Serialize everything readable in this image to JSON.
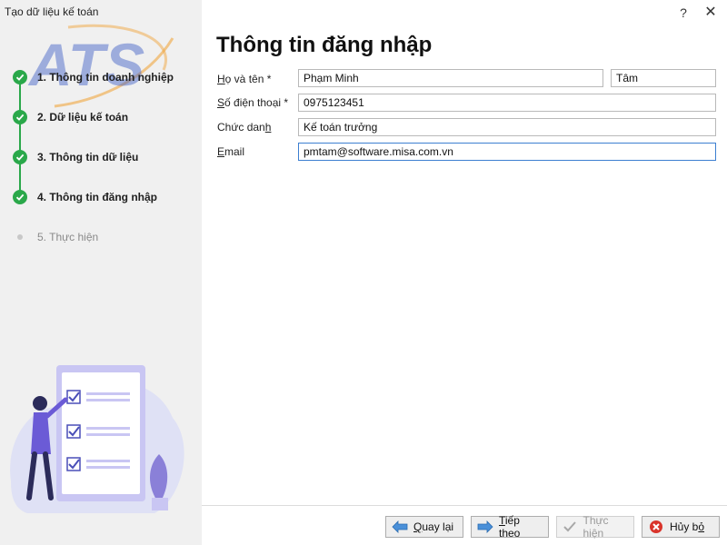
{
  "window": {
    "title": "Tạo dữ liệu kế toán",
    "help": "?",
    "close": "✕"
  },
  "logo": {
    "text": "ATS"
  },
  "steps": [
    {
      "label": "1. Thông tin doanh nghiệp",
      "done": true
    },
    {
      "label": "2. Dữ liệu kế toán",
      "done": true
    },
    {
      "label": "3. Thông tin dữ liệu",
      "done": true
    },
    {
      "label": "4. Thông tin đăng nhập",
      "done": true
    },
    {
      "label": "5. Thực hiện",
      "done": false
    }
  ],
  "form": {
    "title": "Thông tin đăng nhập",
    "fullname": {
      "label_u": "H",
      "label_rest": "ọ và tên *",
      "last": "Phạm Minh",
      "first": "Tâm"
    },
    "phone": {
      "label_u": "S",
      "label_rest": "ố điện thoại *",
      "value": "0975123451"
    },
    "position": {
      "label_pre": "Chức dan",
      "label_u": "h",
      "value": "Kế toán trưởng"
    },
    "email": {
      "label_u": "E",
      "label_rest": "mail",
      "value": "pmtam@software.misa.com.vn"
    }
  },
  "buttons": {
    "back": {
      "u": "Q",
      "rest": "uay lại"
    },
    "next": {
      "u": "T",
      "rest": "iếp theo"
    },
    "execute": {
      "label": "Thực hiện"
    },
    "cancel": {
      "pre": "Hủy b",
      "u": "ỏ"
    }
  },
  "colors": {
    "accent_green": "#2aa84a",
    "logo_blue": "#3b5cc6",
    "logo_orange": "#f0a640",
    "illus_purple": "#6b5bd6"
  }
}
